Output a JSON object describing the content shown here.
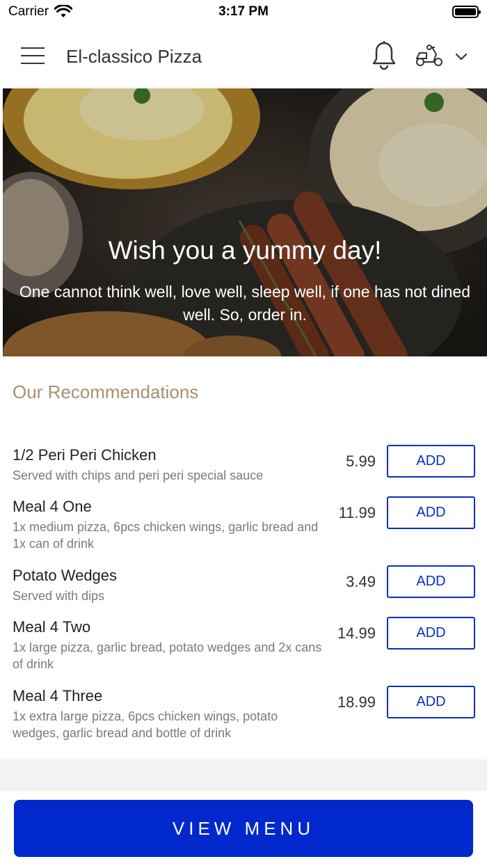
{
  "status_bar": {
    "carrier": "Carrier",
    "time": "3:17 PM"
  },
  "header": {
    "title": "El-classico Pizza"
  },
  "hero": {
    "heading": "Wish you a yummy day!",
    "text": "One cannot think well, love well, sleep well, if one has not dined well. So, order in."
  },
  "recommendations": {
    "title": "Our Recommendations",
    "add_label": "ADD",
    "items": [
      {
        "name": "1/2 Peri Peri Chicken",
        "description": "Served with chips and peri peri special sauce",
        "price": "5.99"
      },
      {
        "name": "Meal 4 One",
        "description": "1x medium pizza, 6pcs chicken wings, garlic bread and 1x can of drink",
        "price": "11.99"
      },
      {
        "name": "Potato Wedges",
        "description": "Served with dips",
        "price": "3.49"
      },
      {
        "name": "Meal 4 Two",
        "description": "1x large pizza, garlic bread, potato wedges and 2x cans of drink",
        "price": "14.99"
      },
      {
        "name": "Meal 4 Three",
        "description": "1x extra large pizza, 6pcs chicken wings, potato wedges, garlic bread and bottle of drink",
        "price": "18.99"
      }
    ]
  },
  "footer": {
    "button_label": "VIEW MENU"
  },
  "colors": {
    "accent": "#0028cc",
    "section_title": "#a89070",
    "add_border": "#0a2fbf"
  }
}
